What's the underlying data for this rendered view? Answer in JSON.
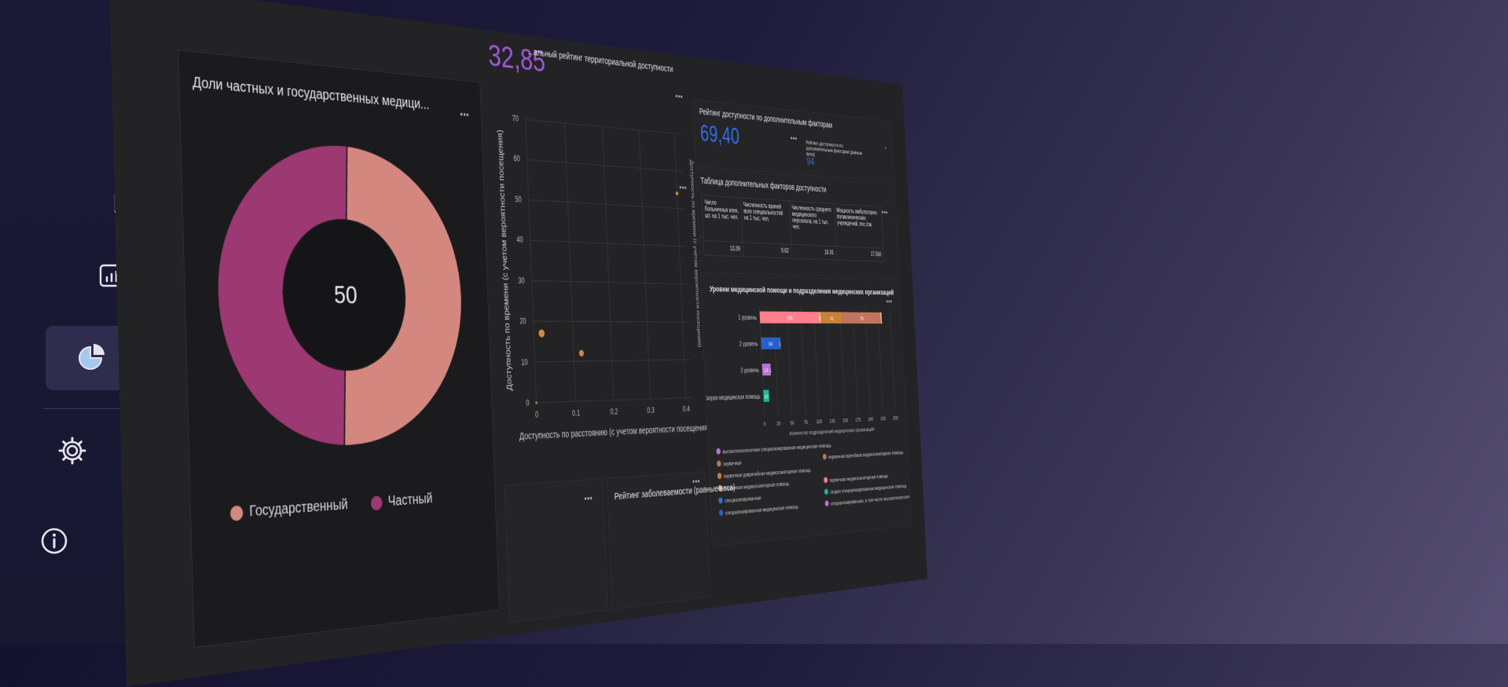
{
  "sidebar": {
    "items": [
      {
        "name": "expand-icon"
      },
      {
        "name": "home-icon"
      },
      {
        "name": "map-icon"
      },
      {
        "name": "report-icon"
      },
      {
        "name": "pie-chart-icon"
      },
      {
        "name": "settings-icon"
      },
      {
        "name": "info-icon"
      }
    ]
  },
  "header": {
    "overall_rating_label": "...альный рейтинг территориальной доступности",
    "overall_rating_value": "32,85",
    "additional_rating_label": "Рейтинг доступности по дополнительным факторам",
    "additional_rating_value": "69,40",
    "equal_weights_label": "Рейтинг доступности по дополнительным факторам (равные веса)",
    "equal_weights_value": "94"
  },
  "donut": {
    "title": "Доли частных и государственных медици...",
    "center_value": "50",
    "legend": [
      {
        "label": "Государственный",
        "color": "#d4877f"
      },
      {
        "label": "Частный",
        "color": "#9c3872"
      }
    ]
  },
  "factors_table": {
    "title": "Таблица дополнительных факторов доступности",
    "headers": [
      "Число больничных коек, шт. на 1 тыс. чел.",
      "Численность врачей всех специальностей на 1 тыс. чел.",
      "Численность среднего медицинского персонала, на 1 тыс. чел.",
      "Мощность амбулаторно-поликлинических учреждений, пос./см."
    ],
    "values": [
      "13.39",
      "9.62",
      "16.91",
      "17.556"
    ]
  },
  "bottom": {
    "morbidity_title": "Рейтинг заболеваемости (равные веса)"
  },
  "chart_data": [
    {
      "type": "pie",
      "title": "Доли частных и государственных медици...",
      "categories": [
        "Государственный",
        "Частный"
      ],
      "values": [
        50,
        50
      ],
      "center_label": "50",
      "colors": [
        "#d4877f",
        "#9c3872"
      ]
    },
    {
      "type": "scatter",
      "xlabel": "Доступность по расстоянию (с учетом вероятности посещения)",
      "ylabel": "Доступность по времени (с учетом вероятности посещения)",
      "y2label": "Доступность по времени (с учетом вероятности посещения)",
      "xlim": [
        0,
        0.42
      ],
      "ylim": [
        0,
        70
      ],
      "xticks": [
        "0",
        "0.1",
        "0.2",
        "0.3",
        "0.4"
      ],
      "yticks": [
        "0",
        "10",
        "20",
        "30",
        "40",
        "50",
        "60",
        "70"
      ],
      "points": [
        {
          "x": 0.0,
          "y": 0,
          "size": 2
        },
        {
          "x": 0.02,
          "y": 17,
          "size": 6
        },
        {
          "x": 0.12,
          "y": 12,
          "size": 5
        },
        {
          "x": 0.4,
          "y": 54,
          "size": 3
        }
      ],
      "color": "#d58a3f"
    },
    {
      "type": "bar",
      "orientation": "horizontal",
      "stacked": true,
      "title": "Уровни медицинской помощи и подразделения медицинских организаций",
      "xlabel": "Количество подразделений медицинских организаций",
      "categories": [
        "1 уровень",
        "2 уровень",
        "3 уровень",
        "Скорая медицинская помощь"
      ],
      "xlim": [
        0,
        250
      ],
      "xticks": [
        "0",
        "25",
        "50",
        "75",
        "100",
        "125",
        "150",
        "175",
        "200",
        "225",
        "250"
      ],
      "series": [
        {
          "name": "первичная медикосанитарная помощь",
          "color": "#ff7f8c",
          "values": [
            108,
            0,
            0,
            0
          ],
          "labels": [
            "108",
            "",
            "",
            ""
          ]
        },
        {
          "name": "первичная",
          "color": "#e3a77a",
          "values": [
            5,
            0,
            0,
            0
          ],
          "labels": [
            "5",
            "",
            "",
            ""
          ]
        },
        {
          "name": "первичная доврачебная медикосанитарная помощь",
          "color": "#c9813a",
          "values": [
            41,
            0,
            0,
            0
          ],
          "labels": [
            "41",
            "",
            "",
            ""
          ]
        },
        {
          "name": "первичная врачебная медикосанитарная помощь",
          "color": "#c2745c",
          "values": [
            76,
            0,
            0,
            0
          ],
          "labels": [
            "76",
            "",
            "",
            ""
          ]
        },
        {
          "name": "специализированная",
          "color": "#ecc9a9",
          "values": [
            2,
            0,
            0,
            0
          ],
          "labels": [
            "",
            "",
            "",
            ""
          ]
        },
        {
          "name": "специализированная медицинская помощь",
          "color": "#2860c9",
          "values": [
            0,
            34,
            0,
            0
          ],
          "labels": [
            "",
            "34",
            "",
            ""
          ]
        },
        {
          "name": "специализированная, в том числе высокотехнологичная, медицинская помощь",
          "color": "#4d8be8",
          "values": [
            0,
            1,
            0,
            0
          ],
          "labels": [
            "",
            "1",
            "",
            ""
          ]
        },
        {
          "name": "высокотехнологичная специализированная медицинская помощь",
          "color": "#b874d6",
          "values": [
            0,
            0,
            14,
            0
          ],
          "labels": [
            "",
            "",
            "14",
            ""
          ]
        },
        {
          "name": "высокотехнологичная",
          "color": "#d79be8",
          "values": [
            0,
            0,
            1,
            0
          ],
          "labels": [
            "",
            "",
            "1",
            ""
          ]
        },
        {
          "name": "скорая специализированная медицинская помощь",
          "color": "#17b999",
          "values": [
            0,
            0,
            0,
            10
          ],
          "labels": [
            "",
            "",
            "",
            "10"
          ]
        }
      ],
      "legend": [
        {
          "label": "высокотехнологичная специализированная медицинская помощь",
          "color": "#b874d6"
        },
        {
          "label": "первичная",
          "color": "#c2745c"
        },
        {
          "label": "первичная врачебная медикосанитарная помощь",
          "color": "#c2745c"
        },
        {
          "label": "первичная доврачебная медикосанитарная помощь",
          "color": "#c9813a"
        },
        {
          "label": "первичная медикосанитарная помощь",
          "color": "#e3a77a"
        },
        {
          "label": "первичная медикосанитарная помощь",
          "color": "#ff7f8c"
        },
        {
          "label": "специализированная",
          "color": "#2f6fd6"
        },
        {
          "label": "скорая специализированная медицинская помощь",
          "color": "#17b999"
        },
        {
          "label": "специализированная медицинская помощь",
          "color": "#2860c9"
        },
        {
          "label": "специализированная, в том числе высокотехнологичная, медицинская помощь",
          "color": "#b874d6"
        }
      ]
    }
  ]
}
